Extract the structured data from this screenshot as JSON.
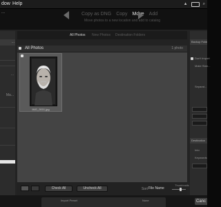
{
  "menubar": {
    "items": [
      "dow",
      "Help"
    ]
  },
  "topbar": {
    "left_fragment": "...",
    "modes": [
      "Copy as DNG",
      "Copy",
      "Move",
      "Add"
    ],
    "active_mode": "Move",
    "sub_text": "Move photos to a new location and add to catalog"
  },
  "left_panel": {
    "header": "...",
    "items": [
      "...",
      "Ma..."
    ]
  },
  "grid": {
    "tabs": [
      "All Photos",
      "New Photos",
      "Destination Folders"
    ],
    "header_title": "All Photos",
    "header_right": "1 photo",
    "photo_caption": "IMG_0001.jpg"
  },
  "toolbar": {
    "check_all": "Check All",
    "uncheck_all": "Uncheck All",
    "sort_label": "Sort",
    "sort_value": "File Name",
    "thumbnails_label": "Thumbnails"
  },
  "right_panel": {
    "header1": "Backup Folder",
    "row1": "Don't Import",
    "row2": "Make Stan...",
    "row3": "Separat...",
    "header2": "Destination",
    "row4": "Into",
    "row5": "Keywords"
  },
  "footer": {
    "left": "Import Preset",
    "value": "None",
    "cancel": "Canc"
  },
  "colors": {
    "background": "#232323",
    "grid": "#444444",
    "accent": "#e8e8e8"
  },
  "icons": [
    "wifi-icon",
    "battery-icon",
    "search-icon",
    "forward-arrow-icon",
    "back-arrow-icon",
    "grid-view-icon",
    "loupe-view-icon"
  ]
}
